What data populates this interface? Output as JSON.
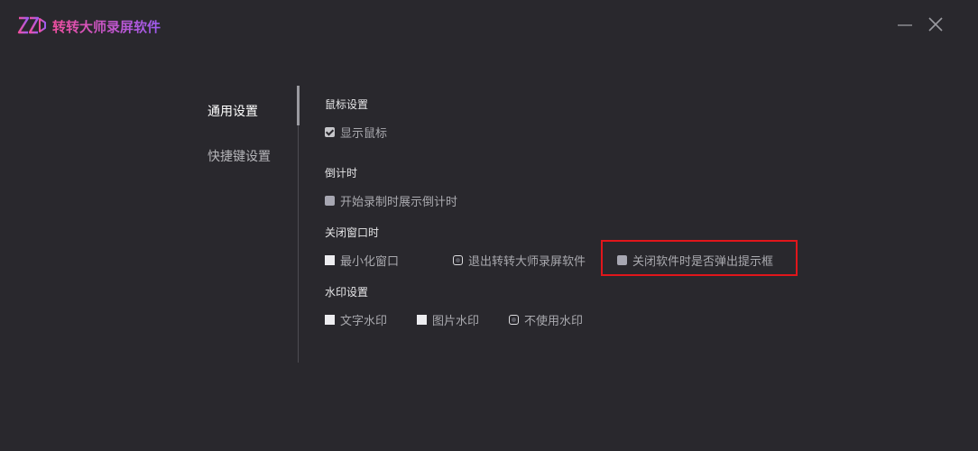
{
  "app": {
    "title": "转转大师录屏软件",
    "logo_icon": "zzd-logo-icon",
    "accent_gradient": [
      "#ef4fa0",
      "#9d5cf0"
    ]
  },
  "window": {
    "minimize_icon": "minimize-icon",
    "close_icon": "close-icon"
  },
  "nav": {
    "items": [
      {
        "label": "通用设置",
        "active": true
      },
      {
        "label": "快捷键设置",
        "active": false
      }
    ]
  },
  "settings": {
    "mouse": {
      "title": "鼠标设置",
      "show_cursor": {
        "label": "显示鼠标",
        "checked": true
      }
    },
    "countdown": {
      "title": "倒计时",
      "show_countdown": {
        "label": "开始录制时展示倒计时",
        "checked": false
      }
    },
    "close_window": {
      "title": "关闭窗口时",
      "options": [
        {
          "label": "最小化窗口",
          "selected": false
        },
        {
          "label": "退出转转大师录屏软件",
          "selected": true
        },
        {
          "label": "关闭软件时是否弹出提示框",
          "checked": false
        }
      ],
      "highlight_color": "#e0161b"
    },
    "watermark": {
      "title": "水印设置",
      "options": [
        {
          "label": "文字水印",
          "selected": false
        },
        {
          "label": "图片水印",
          "selected": false
        },
        {
          "label": "不使用水印",
          "selected": true
        }
      ]
    }
  },
  "colors": {
    "background": "#29282d",
    "text": "#c9c9cc"
  }
}
